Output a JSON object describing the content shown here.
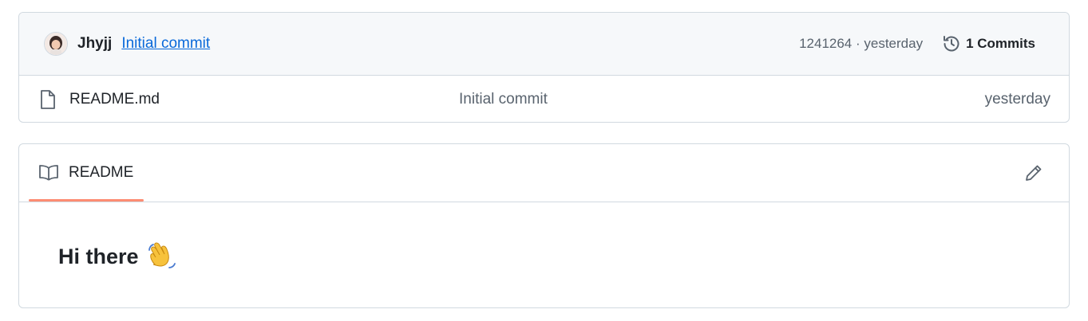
{
  "commit_bar": {
    "author": "Jhyjj",
    "message": "Initial commit",
    "meta": "1241264 · yesterday",
    "commits_label": "1 Commits"
  },
  "files": [
    {
      "icon": "file-icon",
      "name": "README.md",
      "commit_message": "Initial commit",
      "date": "yesterday"
    }
  ],
  "readme": {
    "tab_label": "README",
    "heading": "Hi there",
    "heading_emoji": "waving-hand"
  },
  "colors": {
    "link": "#0969da",
    "border": "#d1d9e0",
    "muted_text": "#59636e",
    "header_bg": "#f6f8fa",
    "tab_underline": "#fd8c73"
  }
}
